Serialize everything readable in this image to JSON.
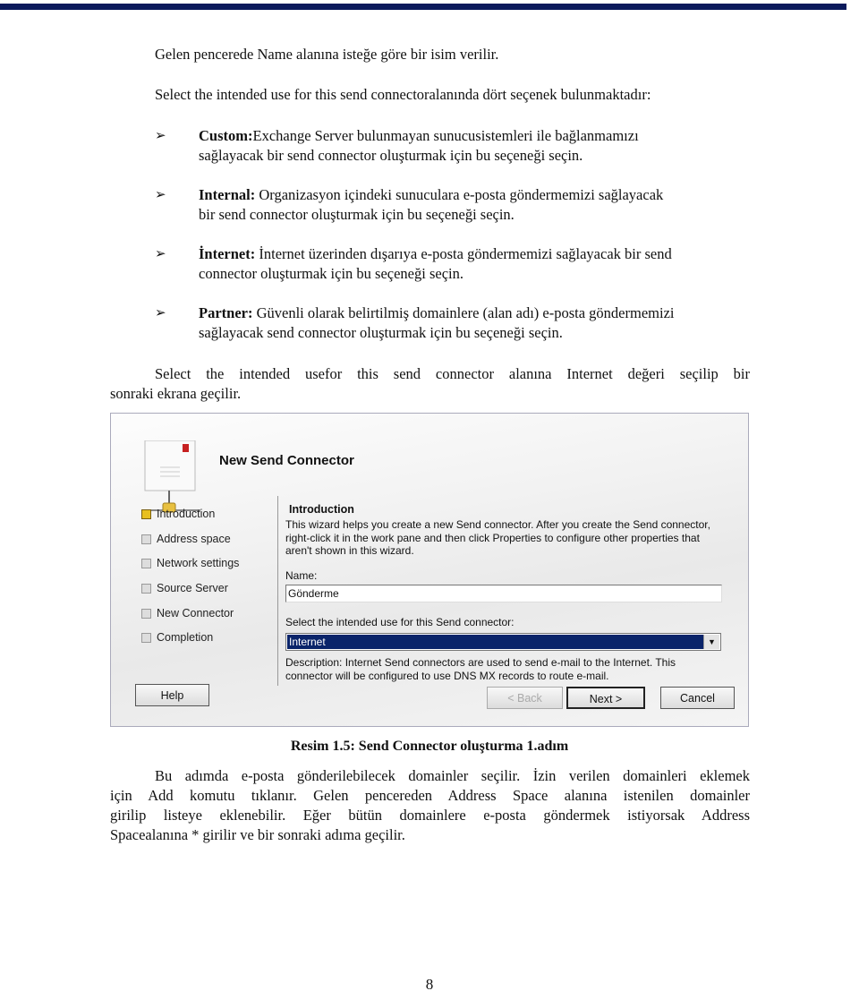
{
  "intro_line1": "Gelen pencerede Name alanına isteğe göre bir isim verilir.",
  "intro_line2": "Select the intended use for this send connectoralanında dört seçenek bulunmaktadır:",
  "bullets": [
    {
      "term": "Custom:",
      "line1": "Exchange Server bulunmayan sunucusistemleri ile bağlanmamızı",
      "line2": "sağlayacak bir send connector oluşturmak için bu seçeneği seçin."
    },
    {
      "term": "Internal:",
      "line1": " Organizasyon içindeki sunuculara e-posta göndermemizi sağlayacak",
      "line2": "bir send connector oluşturmak için bu seçeneği seçin."
    },
    {
      "term": "İnternet:",
      "line1": " İnternet üzerinden dışarıya e-posta göndermemizi sağlayacak bir send",
      "line2": "connector oluşturmak için bu seçeneği seçin."
    },
    {
      "term": "Partner:",
      "line1": " Güvenli olarak belirtilmiş domainlere (alan adı) e-posta göndermemizi",
      "line2": "sağlayacak send connector oluşturmak için bu seçeneği seçin."
    }
  ],
  "para1_line1": "Select the intended usefor this send connector alanına Internet değeri seçilip bir",
  "para1_line2": "sonraki ekrana geçilir.",
  "wizard": {
    "title": "New Send Connector",
    "steps": [
      "Introduction",
      "Address space",
      "Network settings",
      "Source Server",
      "New Connector",
      "Completion"
    ],
    "active_step": 0,
    "section_title": "Introduction",
    "desc_lines": [
      "This wizard helps you create a new Send connector. After you create the Send connector,",
      "right-click it in the work pane and then click Properties to configure other properties that",
      "aren't shown in this wizard."
    ],
    "name_label": "Name:",
    "name_value": "Gönderme",
    "use_label": "Select the intended use for this Send connector:",
    "use_value": "Internet",
    "use_desc_lines": [
      "Description: Internet Send connectors are used to send e-mail to the Internet. This",
      "connector will be configured to use DNS MX records to route e-mail."
    ],
    "help": "Help",
    "back": "< Back",
    "next": "Next >",
    "cancel": "Cancel",
    "selection_color": "#0a246a"
  },
  "caption": "Resim 1.5: Send Connector oluşturma 1.adım",
  "para2": [
    "Bu adımda e-posta gönderilebilecek domainler seçilir. İzin verilen domainleri eklemek",
    "için Add komutu tıklanır. Gelen pencereden Address Space alanına istenilen domainler",
    "girilip listeye eklenebilir. Eğer bütün domainlere e-posta göndermek istiyorsak Address",
    "Spacealanına * girilir ve bir sonraki adıma geçilir."
  ],
  "page_number": "8"
}
